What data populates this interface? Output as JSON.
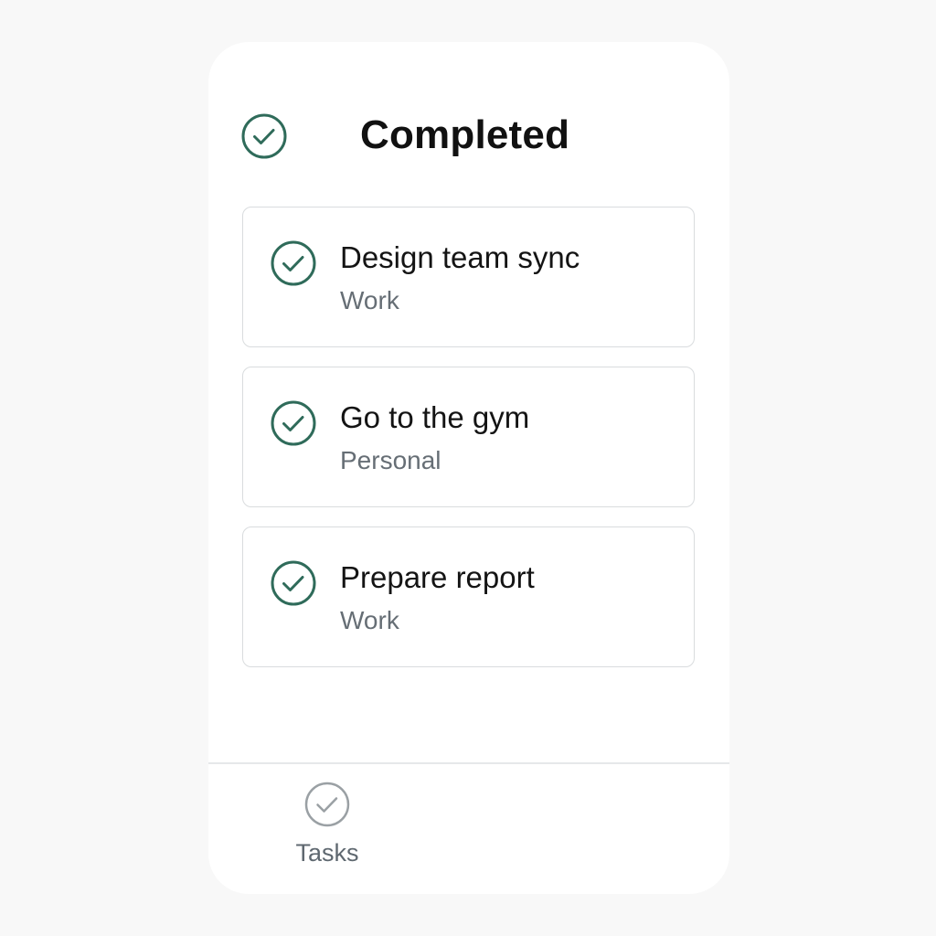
{
  "header": {
    "title": "Completed",
    "icon": "check-circle-icon"
  },
  "colors": {
    "accent": "#2f6b5a",
    "tab_icon": "#9aa0a4",
    "category_text": "#666e75",
    "background": "#f8f8f8"
  },
  "tasks": [
    {
      "title": "Design team sync",
      "category": "Work",
      "status": "completed",
      "icon": "check-circle-icon"
    },
    {
      "title": "Go to the gym",
      "category": "Personal",
      "status": "completed",
      "icon": "check-circle-icon"
    },
    {
      "title": "Prepare report",
      "category": "Work",
      "status": "completed",
      "icon": "check-circle-icon"
    }
  ],
  "tab_bar": {
    "items": [
      {
        "label": "Tasks",
        "icon": "check-circle-icon"
      }
    ]
  }
}
